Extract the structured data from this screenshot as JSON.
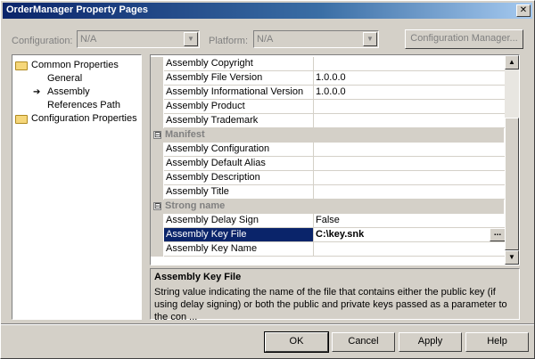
{
  "window": {
    "title": "OrderManager Property Pages",
    "close_glyph": "✕"
  },
  "toolbar": {
    "configuration_label": "Configuration:",
    "configuration_value": "N/A",
    "platform_label": "Platform:",
    "platform_value": "N/A",
    "config_manager_label": "Configuration Manager..."
  },
  "tree": {
    "common": "Common Properties",
    "general": "General",
    "assembly": "Assembly",
    "references": "References Path",
    "configuration": "Configuration Properties"
  },
  "grid": {
    "rows": [
      {
        "name": "Assembly Copyright",
        "value": ""
      },
      {
        "name": "Assembly File Version",
        "value": "1.0.0.0"
      },
      {
        "name": "Assembly Informational Version",
        "value": "1.0.0.0"
      },
      {
        "name": "Assembly Product",
        "value": ""
      },
      {
        "name": "Assembly Trademark",
        "value": ""
      },
      {
        "category": "Manifest",
        "toggle": "⊟"
      },
      {
        "name": "Assembly Configuration",
        "value": ""
      },
      {
        "name": "Assembly Default Alias",
        "value": ""
      },
      {
        "name": "Assembly Description",
        "value": ""
      },
      {
        "name": "Assembly Title",
        "value": ""
      },
      {
        "category": "Strong name",
        "toggle": "⊟"
      },
      {
        "name": "Assembly Delay Sign",
        "value": "False"
      },
      {
        "name": "Assembly Key File",
        "value": "C:\\key.snk",
        "selected": true
      },
      {
        "name": "Assembly Key Name",
        "value": ""
      }
    ],
    "ellipsis_label": "..."
  },
  "description": {
    "title": "Assembly Key File",
    "text": "String value indicating the name of the file that contains either the public key (if using delay signing) or both the public and private keys passed as a parameter to the con ..."
  },
  "buttons": {
    "ok": "OK",
    "cancel": "Cancel",
    "apply": "Apply",
    "help": "Help"
  }
}
